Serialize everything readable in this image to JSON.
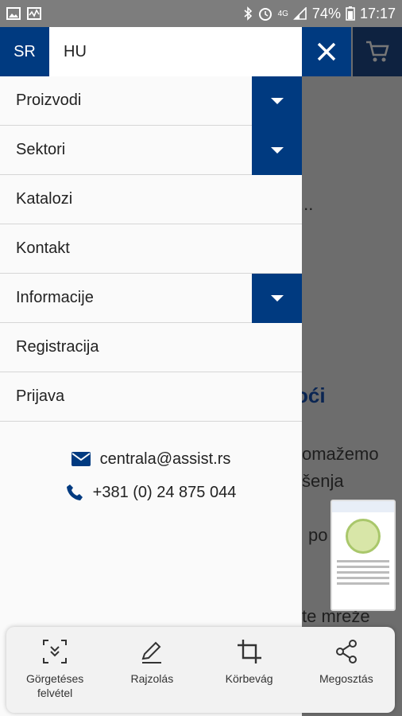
{
  "status_bar": {
    "battery": "74%",
    "time": "17:17",
    "network": "4G"
  },
  "drawer": {
    "lang_active": "SR",
    "lang_other": "HU",
    "menu": [
      {
        "label": "Proizvodi",
        "has_submenu": true
      },
      {
        "label": "Sektori",
        "has_submenu": true
      },
      {
        "label": "Katalozi",
        "has_submenu": false
      },
      {
        "label": "Kontakt",
        "has_submenu": false
      },
      {
        "label": "Informacije",
        "has_submenu": true
      },
      {
        "label": "Registracija",
        "has_submenu": false
      },
      {
        "label": "Prijava",
        "has_submenu": false
      }
    ],
    "email": "centrala@assist.rs",
    "phone": "+381 (0) 24 875 044"
  },
  "background_page": {
    "ellipsis": "...",
    "heading_fragment": "oći",
    "text_lines": [
      "omažemo",
      "šenja",
      "po",
      "te  mreže"
    ]
  },
  "toolbar": {
    "items": [
      {
        "label": "Görgetéses\nfelvétel",
        "icon": "scroll-capture-icon"
      },
      {
        "label": "Rajzolás",
        "icon": "pencil-icon"
      },
      {
        "label": "Körbevág",
        "icon": "crop-icon"
      },
      {
        "label": "Megosztás",
        "icon": "share-icon"
      }
    ]
  },
  "colors": {
    "brand_blue": "#003a80",
    "drawer_bg": "#fafafa",
    "overlay": "#6d6d6d"
  }
}
